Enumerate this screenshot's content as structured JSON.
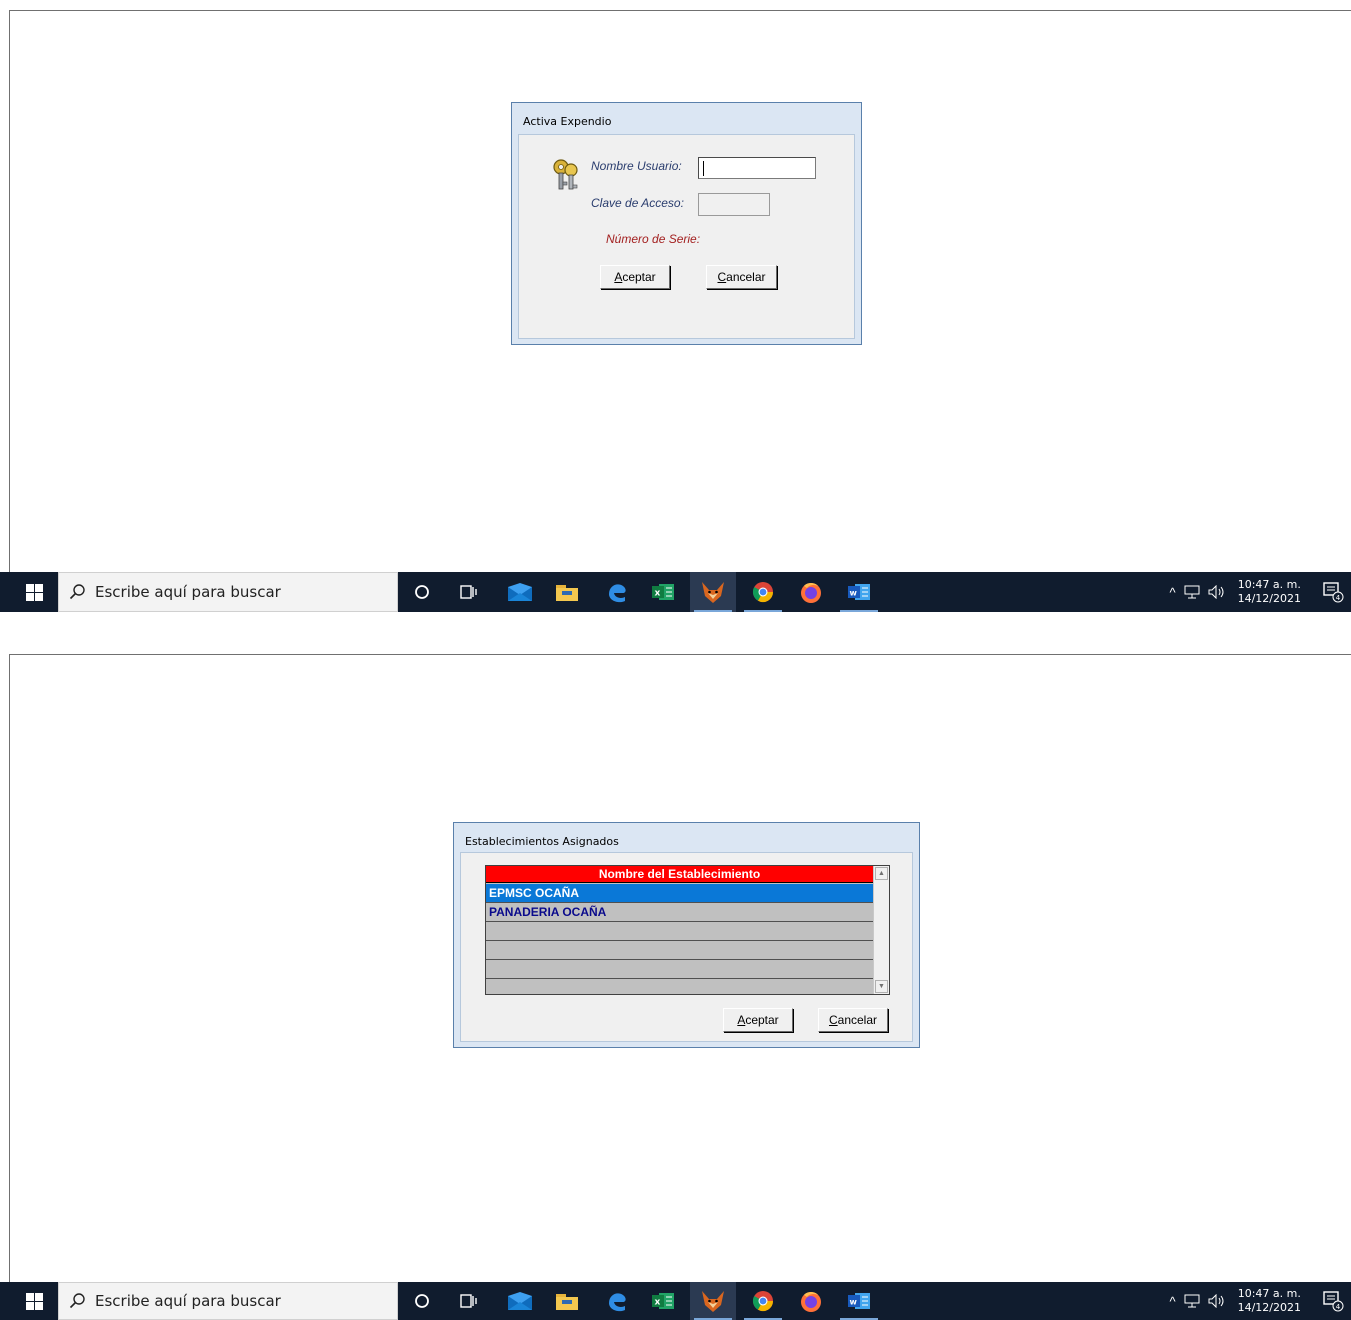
{
  "login_dialog": {
    "title": "Activa Expendio",
    "username_label": "Nombre Usuario:",
    "username_value": "",
    "password_label": "Clave de Acceso:",
    "password_value": "",
    "serial_label": "Número de Serie:",
    "accept_hotkey": "A",
    "accept_rest": "ceptar",
    "cancel_hotkey": "C",
    "cancel_rest": "ancelar"
  },
  "establishments_dialog": {
    "title": "Establecimientos Asignados",
    "column_header": "Nombre del Establecimiento",
    "rows": [
      "EPMSC OCAÑA",
      "PANADERIA OCAÑA",
      "",
      "",
      "",
      ""
    ],
    "selected_index": 0,
    "accept_hotkey": "A",
    "accept_rest": "ceptar",
    "cancel_hotkey": "C",
    "cancel_rest": "ancelar"
  },
  "taskbar": {
    "search_placeholder": "Escribe aquí para buscar",
    "apps": [
      "cortana-icon",
      "task-view-icon",
      "mail-icon",
      "file-explorer-icon",
      "edge-icon",
      "excel-icon",
      "fox-app-icon",
      "chrome-icon",
      "firefox-icon",
      "word-icon"
    ],
    "active_app": "fox-app-icon",
    "time": "10:47 a. m.",
    "date": "14/12/2021",
    "notification_count": "4"
  },
  "colors": {
    "taskbar_bg": "#101c2e",
    "grid_header": "#ff0000",
    "grid_selected": "#0a78d7",
    "label_blue": "#2a3d6e",
    "label_red": "#a32020"
  }
}
